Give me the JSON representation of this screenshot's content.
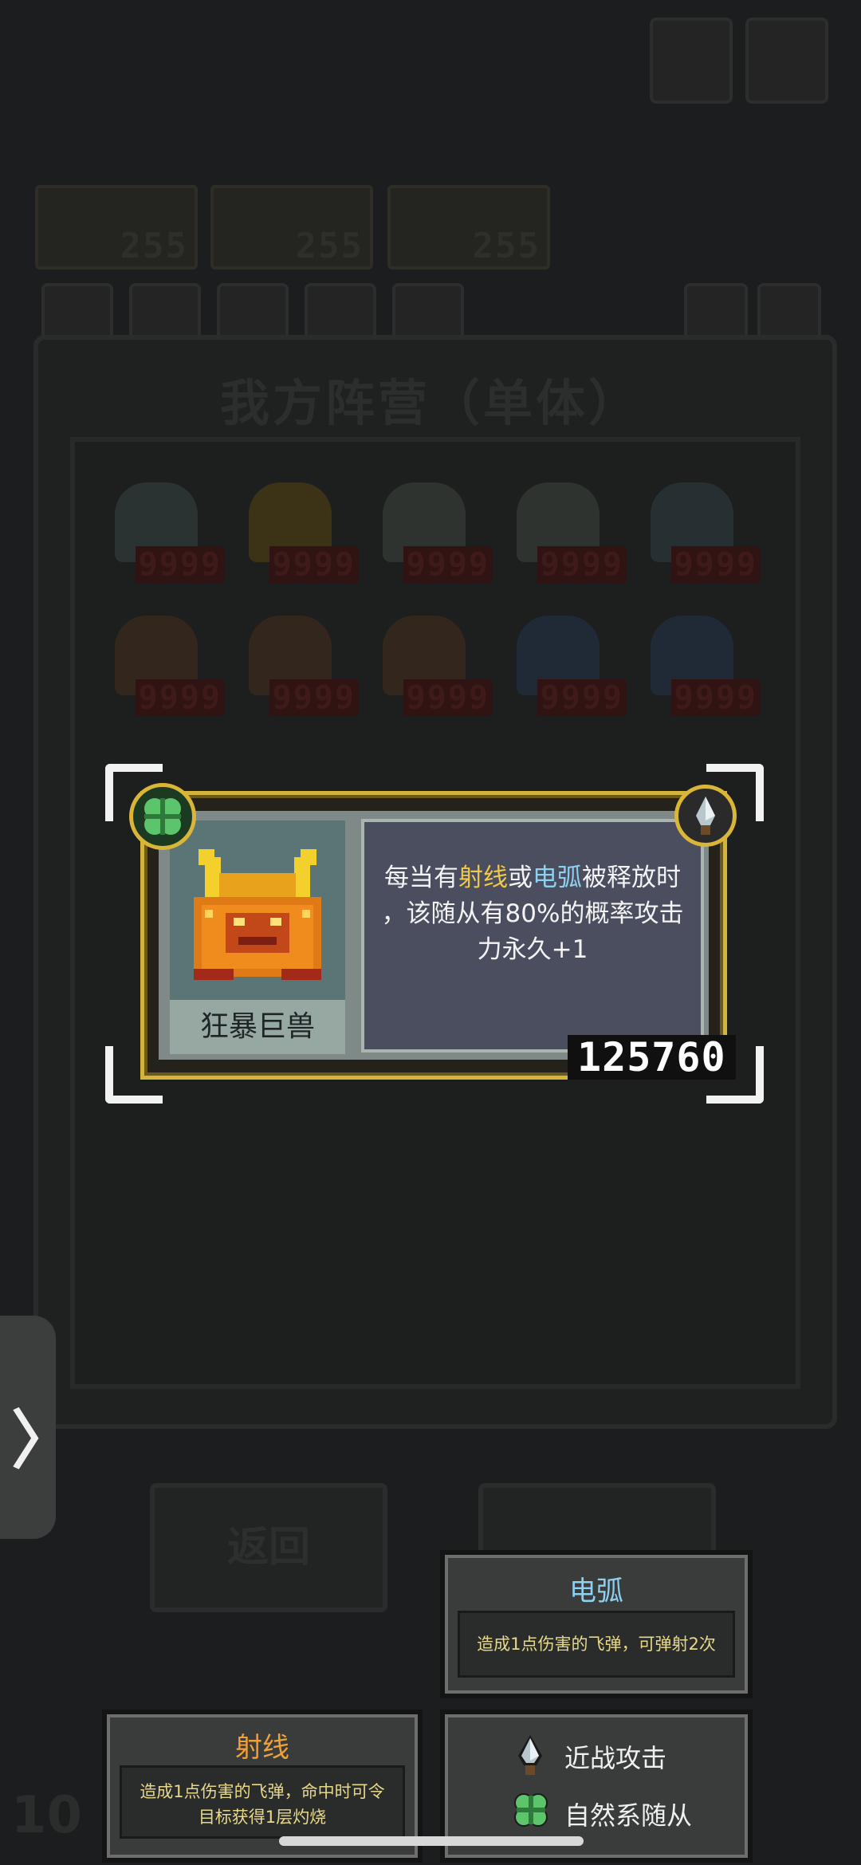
{
  "background": {
    "panel_title": "我方阵营（单体）",
    "resources": [
      "255",
      "255",
      "255"
    ],
    "unit_hp": [
      "9999",
      "9999",
      "9999",
      "9999",
      "9999",
      "9999",
      "9999",
      "9999",
      "9999",
      "9999"
    ],
    "back_button": "返回",
    "round_number": "10"
  },
  "side_handle": {
    "icon": "chevron-right-icon",
    "label": "〉"
  },
  "unit_card": {
    "name": "狂暴巨兽",
    "desc_line1_a": "每当有",
    "desc_line1_kw1": "射线",
    "desc_line1_b": "或",
    "desc_line1_kw2": "电弧",
    "desc_line1_c": "被释放时",
    "desc_line2": "，该随从有80%的概率攻击",
    "desc_line3": "力永久+1",
    "score": "125760",
    "badges": [
      "clover-icon",
      "knife-icon"
    ]
  },
  "tooltips": {
    "arc": {
      "title": "电弧",
      "body": "造成1点伤害的飞弹，可弹射2次"
    },
    "ray": {
      "title": "射线",
      "body_line1": "造成1点伤害的飞弹，命中时可令",
      "body_line2": "目标获得1层灼烧"
    },
    "legend": [
      {
        "icon": "knife-icon",
        "label": "近战攻击"
      },
      {
        "icon": "clover-icon",
        "label": "自然系随从"
      }
    ]
  },
  "colors": {
    "accent_gold": "#d4b43a",
    "keyword_yellow": "#f0c84a",
    "keyword_blue": "#8ed0ef",
    "tooltip_title_blue": "#8ed0ef",
    "tooltip_title_orange": "#f0a23a"
  }
}
